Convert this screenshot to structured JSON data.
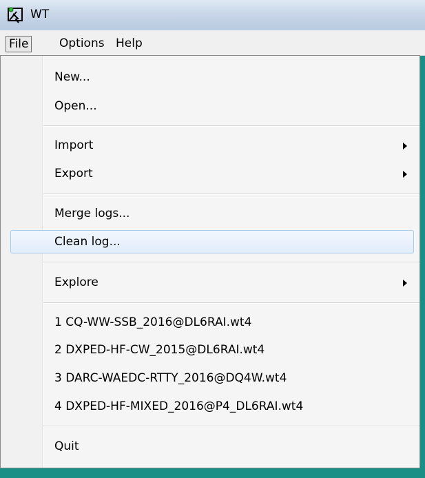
{
  "window": {
    "title": "WT"
  },
  "menubar": {
    "items": [
      "File",
      "Options",
      "Help"
    ]
  },
  "file_menu": {
    "items": [
      {
        "label": "New...",
        "submenu": false
      },
      {
        "label": "Open...",
        "submenu": false
      },
      {
        "label": "Import",
        "submenu": true
      },
      {
        "label": "Export",
        "submenu": true
      },
      {
        "label": "Merge logs...",
        "submenu": false
      },
      {
        "label": "Clean log...",
        "submenu": false,
        "highlighted": true
      },
      {
        "label": "Explore",
        "submenu": true
      },
      {
        "label": "1 CQ-WW-SSB_2016@DL6RAI.wt4",
        "submenu": false
      },
      {
        "label": "2 DXPED-HF-CW_2015@DL6RAI.wt4",
        "submenu": false
      },
      {
        "label": "3 DARC-WAEDC-RTTY_2016@DQ4W.wt4",
        "submenu": false
      },
      {
        "label": "4 DXPED-HF-MIXED_2016@P4_DL6RAI.wt4",
        "submenu": false
      },
      {
        "label": "Quit",
        "submenu": false
      }
    ]
  },
  "colors": {
    "desktop": "#1a8f86",
    "menu_bg": "#f5f5f5",
    "highlight_border": "#a8cbea"
  }
}
